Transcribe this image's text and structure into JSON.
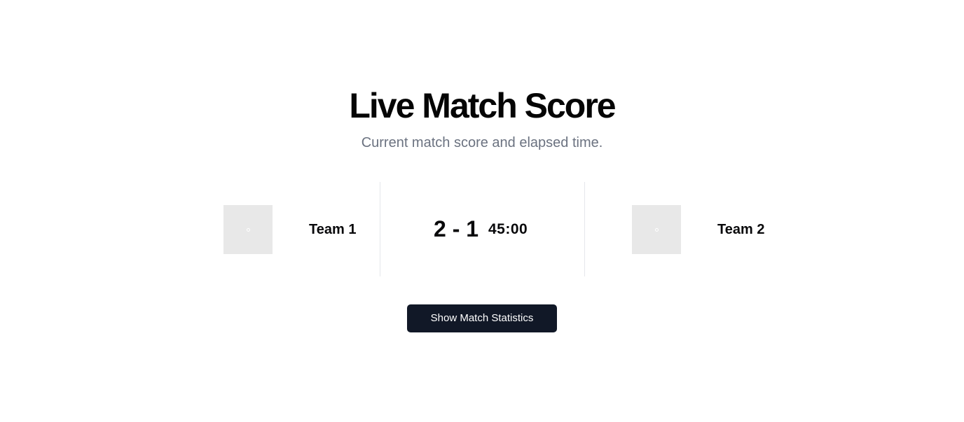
{
  "header": {
    "title": "Live Match Score",
    "subtitle": "Current match score and elapsed time."
  },
  "match": {
    "home_team": {
      "name": "Team 1",
      "logo_icon": "team-logo-placeholder"
    },
    "away_team": {
      "name": "Team 2",
      "logo_icon": "team-logo-placeholder"
    },
    "score": "2 - 1",
    "elapsed_time": "45:00"
  },
  "actions": {
    "stats_button_label": "Show Match Statistics"
  },
  "colors": {
    "button_background": "#111827",
    "subtitle_text": "#6b7280",
    "logo_placeholder": "#e8e8e8",
    "divider": "#e5e7eb"
  }
}
